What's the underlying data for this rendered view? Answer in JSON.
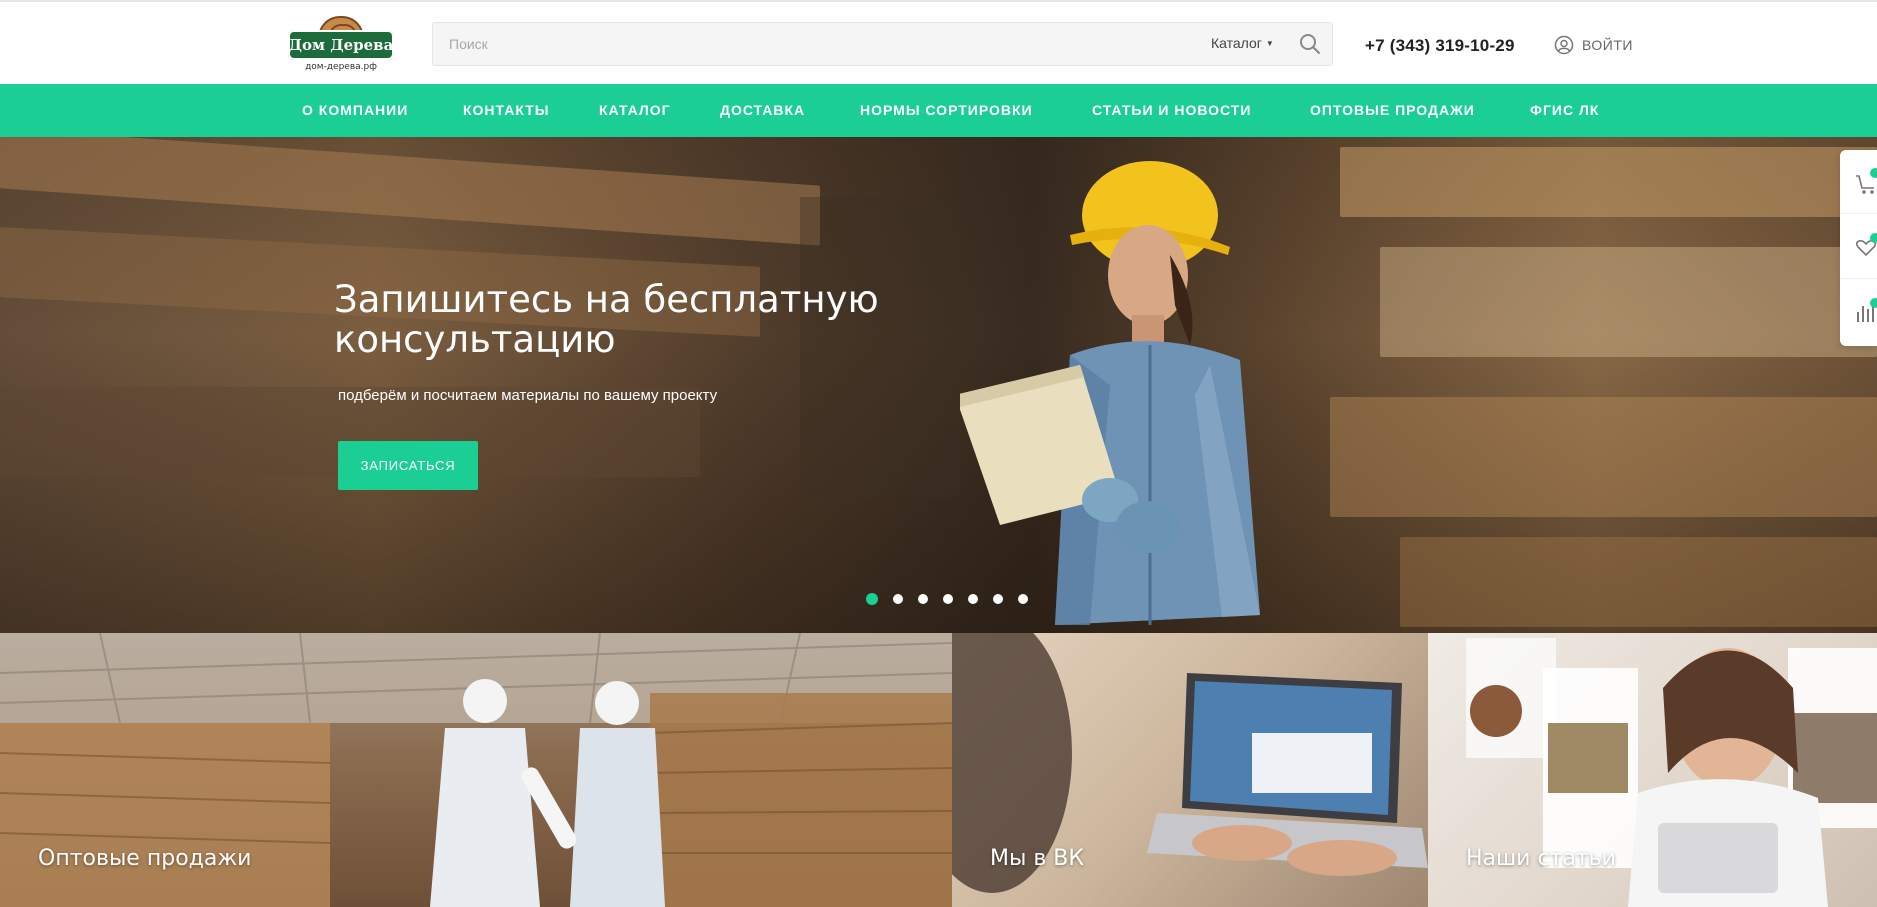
{
  "header": {
    "logo_title": "Дом Дерева",
    "logo_subtitle": "дом-дерева.рф",
    "search_placeholder": "Поиск",
    "search_category": "Каталог",
    "phone": "+7 (343) 319-10-29",
    "login_label": "ВОЙТИ"
  },
  "nav": {
    "items": [
      {
        "label": "О КОМПАНИИ"
      },
      {
        "label": "КОНТАКТЫ"
      },
      {
        "label": "КАТАЛОГ"
      },
      {
        "label": "ДОСТАВКА"
      },
      {
        "label": "НОРМЫ СОРТИРОВКИ"
      },
      {
        "label": "СТАТЬИ И НОВОСТИ"
      },
      {
        "label": "ОПТОВЫЕ ПРОДАЖИ"
      },
      {
        "label": "ФГИС ЛК"
      }
    ]
  },
  "hero": {
    "title": "Запишитесь на бесплатную консультацию",
    "subtitle": "подберём и посчитаем материалы по вашему проекту",
    "button_label": "ЗАПИСАТЬСЯ",
    "slide_count": 7,
    "active_slide": 1
  },
  "side_panel": {
    "icons": [
      "cart-icon",
      "heart-icon",
      "compare-icon"
    ]
  },
  "tiles": [
    {
      "label": "Оптовые продажи"
    },
    {
      "label": "Мы в ВК"
    },
    {
      "label": "Наши статьи"
    }
  ],
  "colors": {
    "accent": "#1bcf94",
    "logo_green": "#1c6b3a"
  }
}
